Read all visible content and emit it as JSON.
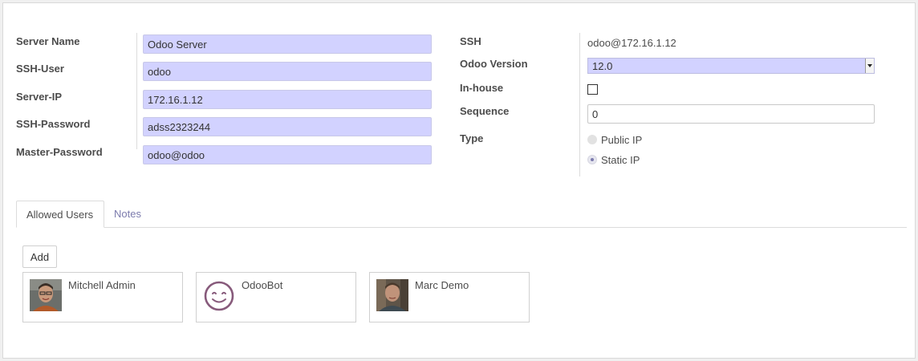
{
  "form": {
    "left_fields": [
      {
        "label": "Server Name",
        "value": "Odoo Server"
      },
      {
        "label": "SSH-User",
        "value": "odoo"
      },
      {
        "label": "Server-IP",
        "value": "172.16.1.12"
      },
      {
        "label": "SSH-Password",
        "value": "adss2323244"
      },
      {
        "label": "Master-Password",
        "value": "odoo@odoo"
      }
    ],
    "right": {
      "ssh_label": "SSH",
      "ssh_value": "odoo@172.16.1.12",
      "version_label": "Odoo Version",
      "version_value": "12.0",
      "inhouse_label": "In-house",
      "inhouse_checked": false,
      "sequence_label": "Sequence",
      "sequence_value": "0",
      "type_label": "Type",
      "type_options": [
        {
          "label": "Public IP",
          "selected": false
        },
        {
          "label": "Static IP",
          "selected": true
        }
      ]
    }
  },
  "tabs": [
    {
      "label": "Allowed Users",
      "active": true
    },
    {
      "label": "Notes",
      "active": false
    }
  ],
  "users_section": {
    "add_label": "Add",
    "users": [
      {
        "name": "Mitchell Admin",
        "avatar": "person-photo-icon"
      },
      {
        "name": "OdooBot",
        "avatar": "odoobot-smiley-icon"
      },
      {
        "name": "Marc Demo",
        "avatar": "person-photo-icon"
      }
    ]
  },
  "colors": {
    "required_field_bg": "#d2d2ff",
    "accent": "#7c7bad",
    "odoobot_purple": "#875a7b"
  }
}
